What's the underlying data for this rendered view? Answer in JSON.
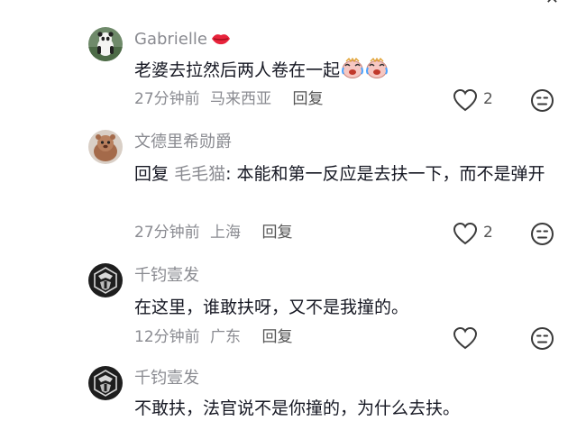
{
  "comments": [
    {
      "username": "Gabrielle",
      "username_icon": "lips-emoji-icon",
      "text": "老婆去拉然后两人卷在一起",
      "text_emojis": [
        "crying-laughing-face-emoji",
        "crying-laughing-face-emoji"
      ],
      "time": "27分钟前",
      "location": "马来西亚",
      "reply_label": "回复",
      "likes": "2"
    },
    {
      "username": "文德里希勋爵",
      "reply_prefix": "回复",
      "mention": "毛毛猫",
      "text": ": 本能和第一反应是去扶一下，而不是弹开",
      "time": "27分钟前",
      "location": "上海",
      "reply_label": "回复",
      "likes": "2"
    },
    {
      "username": "千钧壹发",
      "text": "在这里，谁敢扶呀，又不是我撞的。",
      "time": "12分钟前",
      "location": "广东",
      "reply_label": "回复",
      "likes": ""
    },
    {
      "username": "千钧壹发",
      "text": "不敢扶，法官说不是你撞的，为什么去扶。"
    }
  ],
  "colors": {
    "primary_text": "#161823",
    "secondary_text": "#8a8b91",
    "icon_stroke": "#3a3a3a",
    "background": "#ffffff"
  }
}
